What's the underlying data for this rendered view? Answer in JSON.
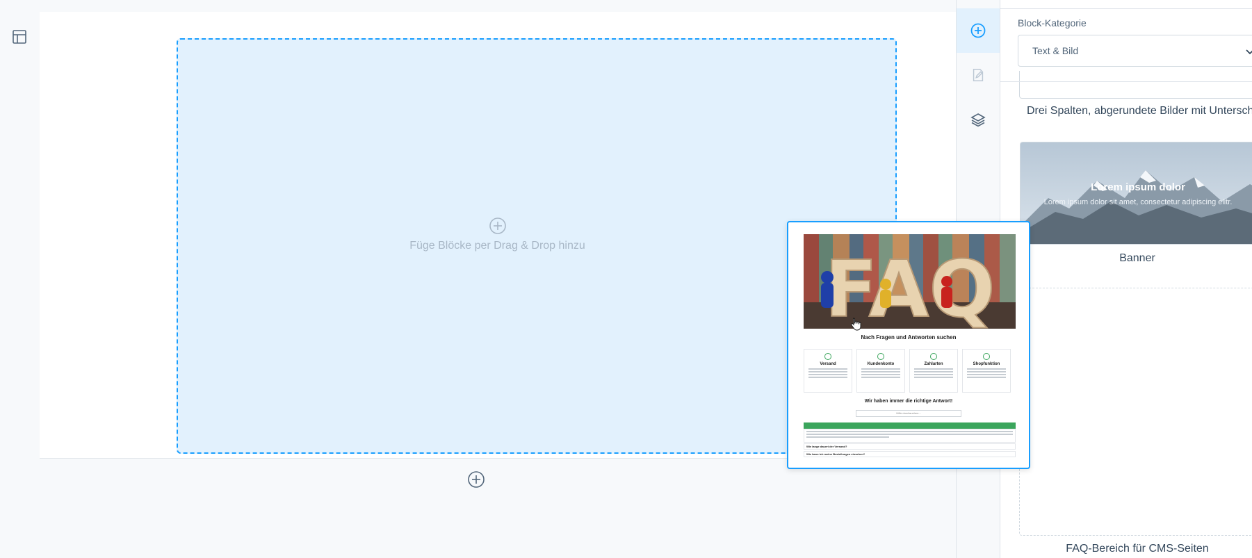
{
  "canvas": {
    "dropzone_hint": "Füge Blöcke per Drag & Drop hinzu"
  },
  "toolbar": {
    "items": [
      {
        "icon": "plus-circle-icon",
        "active": true
      },
      {
        "icon": "edit-icon",
        "active": false
      },
      {
        "icon": "layers-icon",
        "active": false
      }
    ]
  },
  "sidebar": {
    "category_label": "Block-Kategorie",
    "category_value": "Text & Bild",
    "blocks": [
      {
        "caption": "Drei Spalten, abgerundete Bilder mit Unterschrift"
      },
      {
        "caption": "Banner",
        "preview_title": "Lorem ipsum dolor",
        "preview_subtitle": "Lorem ipsum dolor sit amet, consectetur adipiscing elitr."
      },
      {
        "caption": "FAQ-Bereich für CMS-Seiten"
      }
    ]
  },
  "drag_preview": {
    "heading": "Nach Fragen und Antworten suchen",
    "features": [
      "Versand",
      "Kundenkonto",
      "Zahlarten",
      "Shopfunktion"
    ],
    "subheading": "Wir haben immer die richtige Antwort!",
    "search_placeholder": "Hilfe durchsuchen...",
    "accordion": [
      "Wie lange dauert der Versand?",
      "Wie kann ich meine Bestellungen einsehen?"
    ]
  },
  "colors": {
    "accent": "#189eff",
    "dropzone_bg": "#e2f1fd",
    "faq_green": "#3ba55c"
  }
}
